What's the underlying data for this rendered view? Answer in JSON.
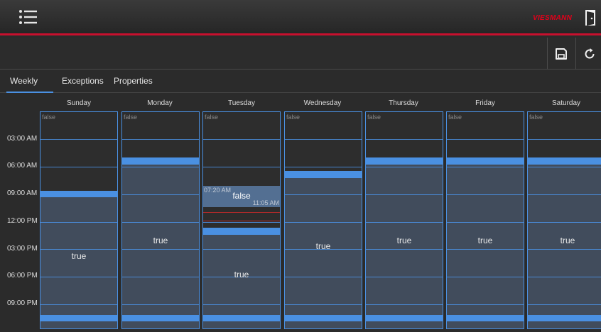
{
  "header": {
    "brand": "VIESMANN",
    "menu_icon": "menu-list-icon",
    "logout_icon": "exit-door-icon",
    "accent_color": "#c8102e"
  },
  "toolbar": {
    "save_icon": "save-icon",
    "reset_icon": "refresh-icon"
  },
  "tabs": [
    {
      "label": "Weekly",
      "active": true
    },
    {
      "label": "Exceptions",
      "active": false
    },
    {
      "label": "Properties",
      "active": false
    }
  ],
  "schedule": {
    "days": [
      "Sunday",
      "Monday",
      "Tuesday",
      "Wednesday",
      "Thursday",
      "Friday",
      "Saturday"
    ],
    "time_labels": [
      "03:00 AM",
      "06:00 AM",
      "09:00 AM",
      "12:00 PM",
      "03:00 PM",
      "06:00 PM",
      "09:00 PM"
    ],
    "false_label": "false",
    "true_label": "true",
    "exception": {
      "label": "false",
      "start": "07:20 AM",
      "end": "11:05 AM"
    }
  }
}
